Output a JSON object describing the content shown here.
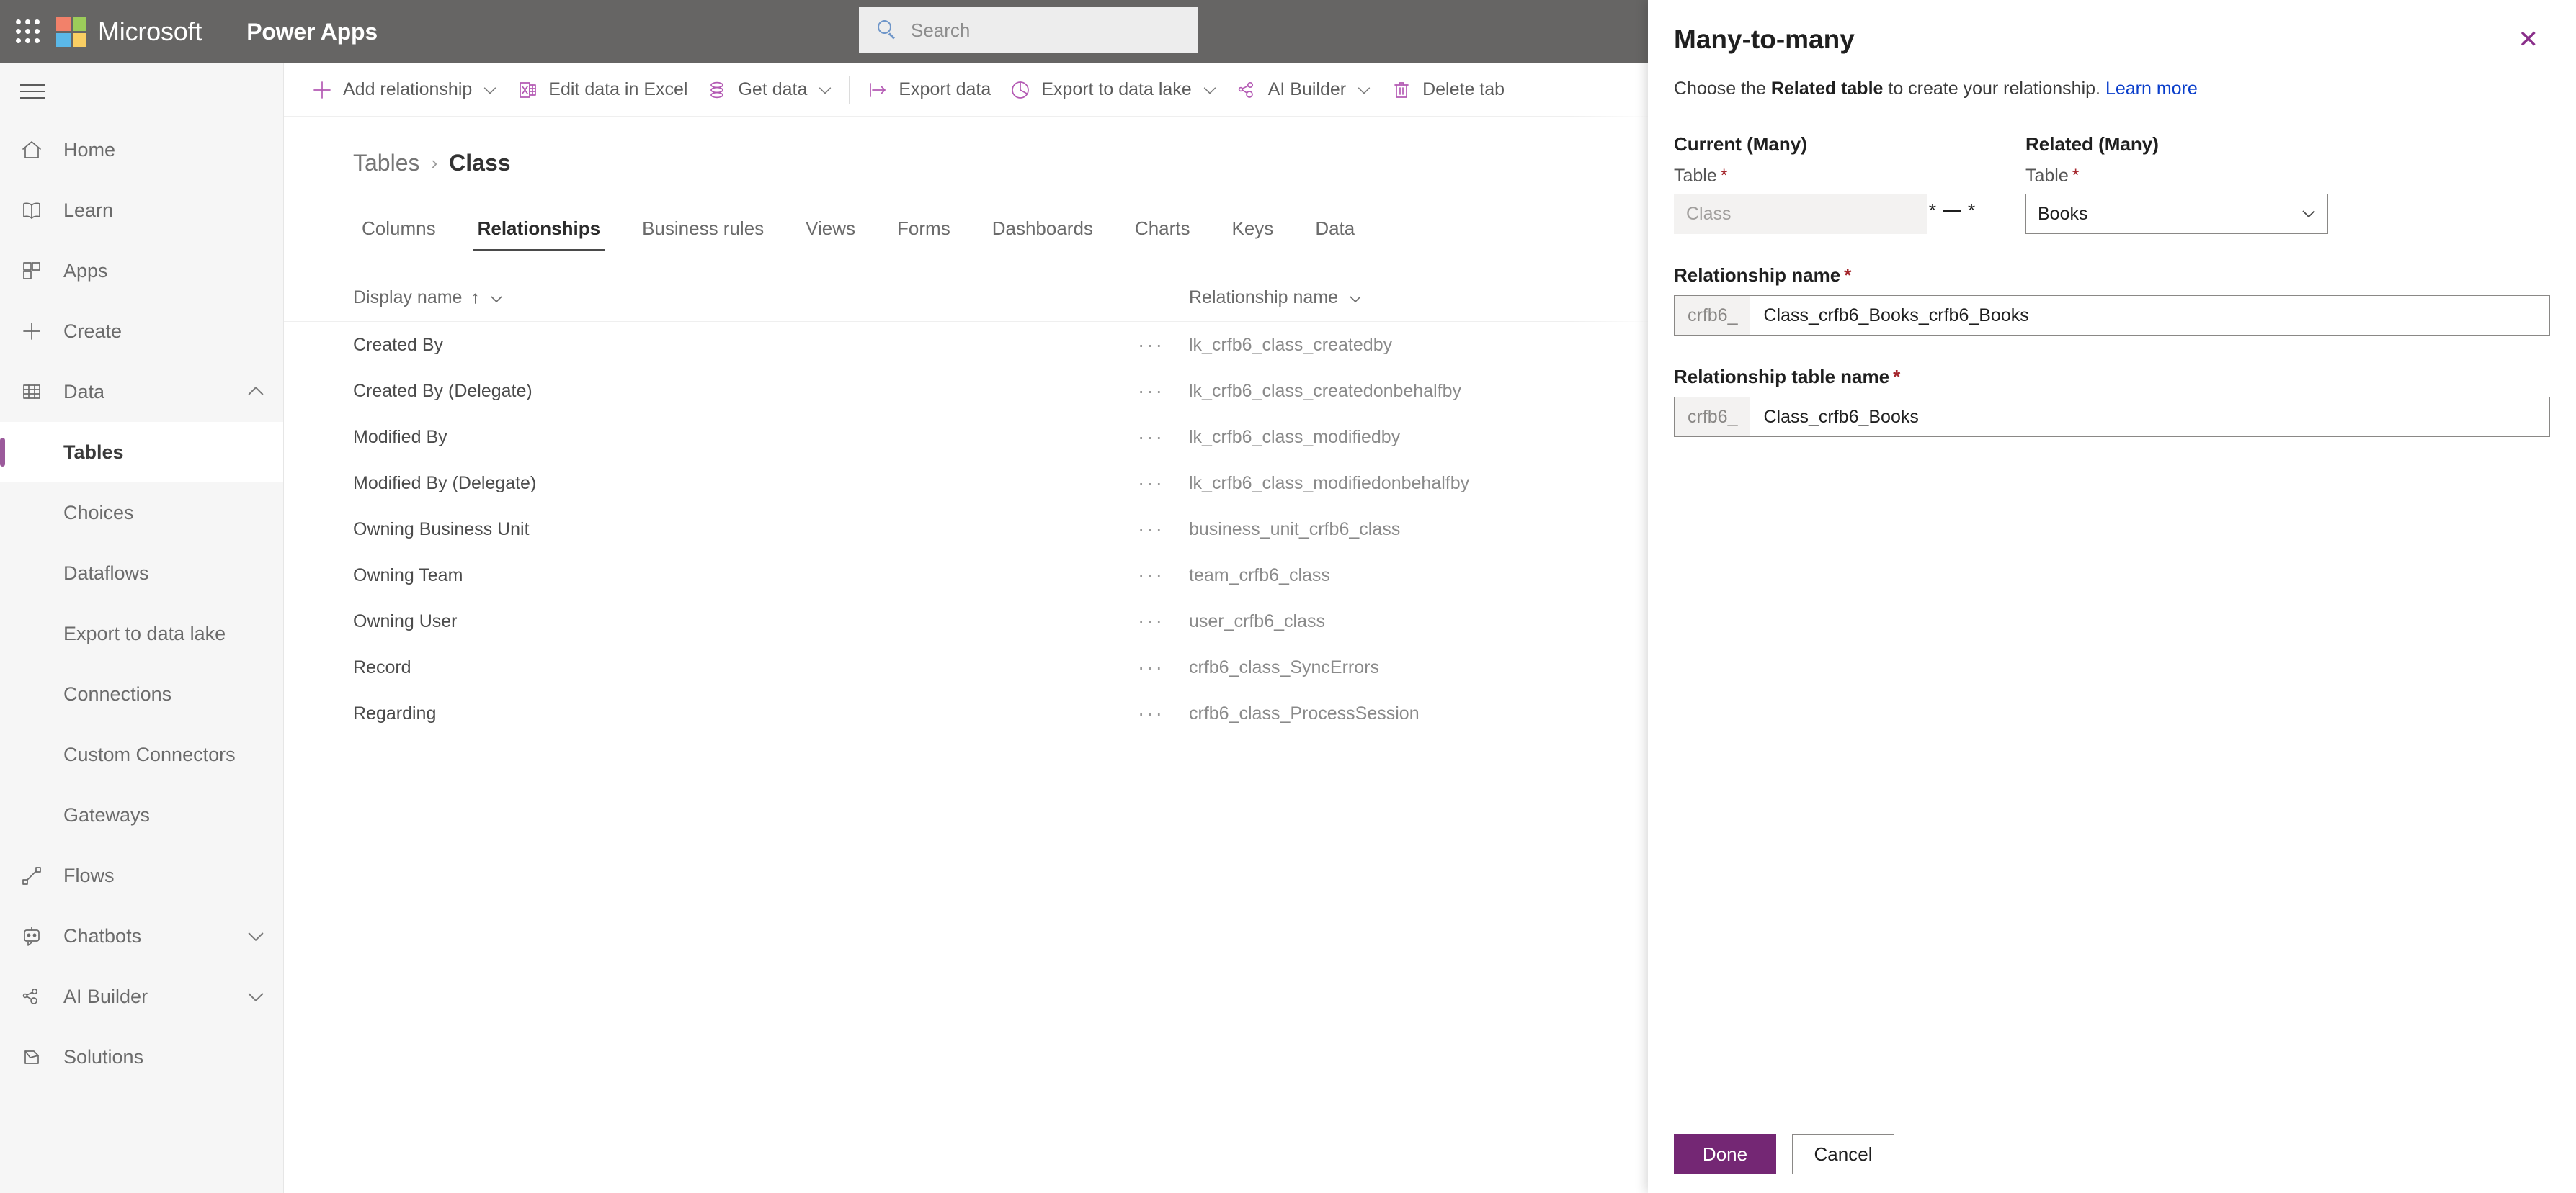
{
  "topbar": {
    "waffle_label": "App launcher",
    "brand": "Microsoft",
    "app_name": "Power Apps",
    "search_placeholder": "Search"
  },
  "sidebar": {
    "items": [
      {
        "label": "Home",
        "icon": "home-icon",
        "level": "top",
        "selected": false,
        "chevron": ""
      },
      {
        "label": "Learn",
        "icon": "book-icon",
        "level": "top",
        "selected": false,
        "chevron": ""
      },
      {
        "label": "Apps",
        "icon": "apps-grid-icon",
        "level": "top",
        "selected": false,
        "chevron": ""
      },
      {
        "label": "Create",
        "icon": "plus-icon",
        "level": "top",
        "selected": false,
        "chevron": ""
      },
      {
        "label": "Data",
        "icon": "table-grid-icon",
        "level": "top",
        "selected": false,
        "chevron": "up"
      },
      {
        "label": "Tables",
        "icon": "",
        "level": "sub",
        "selected": true,
        "chevron": ""
      },
      {
        "label": "Choices",
        "icon": "",
        "level": "sub",
        "selected": false,
        "chevron": ""
      },
      {
        "label": "Dataflows",
        "icon": "",
        "level": "sub",
        "selected": false,
        "chevron": ""
      },
      {
        "label": "Export to data lake",
        "icon": "",
        "level": "sub",
        "selected": false,
        "chevron": ""
      },
      {
        "label": "Connections",
        "icon": "",
        "level": "sub",
        "selected": false,
        "chevron": ""
      },
      {
        "label": "Custom Connectors",
        "icon": "",
        "level": "sub",
        "selected": false,
        "chevron": ""
      },
      {
        "label": "Gateways",
        "icon": "",
        "level": "sub",
        "selected": false,
        "chevron": ""
      },
      {
        "label": "Flows",
        "icon": "flow-icon",
        "level": "top",
        "selected": false,
        "chevron": ""
      },
      {
        "label": "Chatbots",
        "icon": "chatbot-icon",
        "level": "top",
        "selected": false,
        "chevron": "down"
      },
      {
        "label": "AI Builder",
        "icon": "ai-builder-icon",
        "level": "top",
        "selected": false,
        "chevron": "down"
      },
      {
        "label": "Solutions",
        "icon": "solutions-icon",
        "level": "top",
        "selected": false,
        "chevron": ""
      }
    ]
  },
  "commandbar": {
    "items": [
      {
        "label": "Add relationship",
        "icon": "plus-icon",
        "chevron": true,
        "sep_after": false
      },
      {
        "label": "Edit data in Excel",
        "icon": "excel-icon",
        "chevron": false,
        "sep_after": false
      },
      {
        "label": "Get data",
        "icon": "get-data-icon",
        "chevron": true,
        "sep_after": true
      },
      {
        "label": "Export data",
        "icon": "export-data-icon",
        "chevron": false,
        "sep_after": false
      },
      {
        "label": "Export to data lake",
        "icon": "data-lake-icon",
        "chevron": true,
        "sep_after": false
      },
      {
        "label": "AI Builder",
        "icon": "ai-builder-icon",
        "chevron": true,
        "sep_after": false
      },
      {
        "label": "Delete tab",
        "icon": "trash-icon",
        "chevron": false,
        "sep_after": false
      }
    ]
  },
  "breadcrumb": {
    "parent": "Tables",
    "separator": "›",
    "current": "Class"
  },
  "tabs": [
    {
      "label": "Columns",
      "active": false
    },
    {
      "label": "Relationships",
      "active": true
    },
    {
      "label": "Business rules",
      "active": false
    },
    {
      "label": "Views",
      "active": false
    },
    {
      "label": "Forms",
      "active": false
    },
    {
      "label": "Dashboards",
      "active": false
    },
    {
      "label": "Charts",
      "active": false
    },
    {
      "label": "Keys",
      "active": false
    },
    {
      "label": "Data",
      "active": false
    }
  ],
  "grid": {
    "columns": [
      {
        "label": "Display name",
        "sort": "↑"
      },
      {
        "label": "Relationship name",
        "sort": ""
      }
    ],
    "row_menu_glyph": "···",
    "rows": [
      {
        "display_name": "Created By",
        "relationship_name": "lk_crfb6_class_createdby"
      },
      {
        "display_name": "Created By (Delegate)",
        "relationship_name": "lk_crfb6_class_createdonbehalfby"
      },
      {
        "display_name": "Modified By",
        "relationship_name": "lk_crfb6_class_modifiedby"
      },
      {
        "display_name": "Modified By (Delegate)",
        "relationship_name": "lk_crfb6_class_modifiedonbehalfby"
      },
      {
        "display_name": "Owning Business Unit",
        "relationship_name": "business_unit_crfb6_class"
      },
      {
        "display_name": "Owning Team",
        "relationship_name": "team_crfb6_class"
      },
      {
        "display_name": "Owning User",
        "relationship_name": "user_crfb6_class"
      },
      {
        "display_name": "Record",
        "relationship_name": "crfb6_class_SyncErrors"
      },
      {
        "display_name": "Regarding",
        "relationship_name": "crfb6_class_ProcessSession"
      }
    ]
  },
  "panel": {
    "title": "Many-to-many",
    "close_glyph": "✕",
    "description_pre": "Choose the ",
    "description_bold": "Related table",
    "description_post": " to create your relationship. ",
    "learn_more": "Learn more",
    "current": {
      "group_title": "Current (Many)",
      "field_label": "Table",
      "required_mark": "*",
      "value": "Class"
    },
    "cardinality": {
      "left": "*",
      "right": "*"
    },
    "related": {
      "group_title": "Related (Many)",
      "field_label": "Table",
      "required_mark": "*",
      "value": "Books"
    },
    "relationship_name": {
      "label": "Relationship name",
      "required_mark": "*",
      "prefix": "crfb6_",
      "value": "Class_crfb6_Books_crfb6_Books"
    },
    "relationship_table_name": {
      "label": "Relationship table name",
      "required_mark": "*",
      "prefix": "crfb6_",
      "value": "Class_crfb6_Books"
    },
    "footer": {
      "done_label": "Done",
      "cancel_label": "Cancel"
    }
  },
  "colors": {
    "brand_purple": "#742774",
    "sidebar_accent": "#9b5a9b",
    "topbar_bg": "#666564",
    "link_blue": "#0a3ecb",
    "required_red": "#a4262c"
  }
}
